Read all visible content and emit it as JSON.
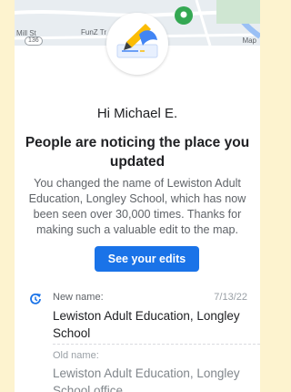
{
  "map": {
    "street_label": "Mill St",
    "route_label": "136",
    "place_label": "FunZ Tr",
    "corner_label": "Map"
  },
  "email": {
    "greeting": "Hi Michael E.",
    "headline": "People are noticing the place you updated",
    "body": "You changed the name of Lewiston Adult Education, Longley School, which has now been seen over 30,000 times. Thanks for making such a valuable edit to the map.",
    "cta_label": "See your edits"
  },
  "edit": {
    "icon": "edit-history-icon",
    "new_label": "New name:",
    "date": "7/13/22",
    "new_value": "Lewiston Adult Education, Longley School",
    "old_label": "Old name:",
    "old_value": "Lewiston Adult Education, Longley School office"
  },
  "colors": {
    "page_background": "#fdf3cf",
    "accent": "#1a73e8",
    "marker": "#34a853"
  }
}
